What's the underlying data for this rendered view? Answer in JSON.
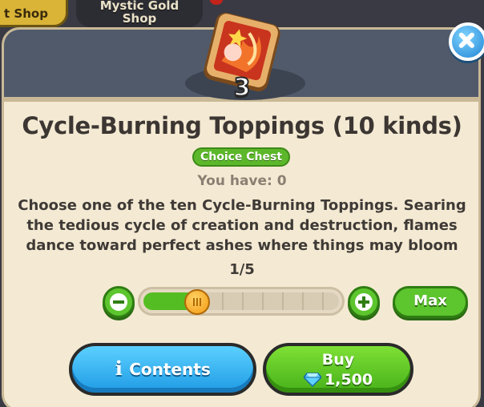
{
  "tabs": {
    "shop": "t Shop",
    "mystic_line1": "Mystic Gold",
    "mystic_line2": "Shop"
  },
  "item": {
    "count": "3",
    "title": "Cycle-Burning Toppings (10 kinds)",
    "badge": "Choice Chest",
    "owned": "You have: 0",
    "description": "Choose one of the ten Cycle-Burning Toppings. Searing the tedious cycle of creation and destruction, flames dance toward perfect ashes where things may bloom evermore."
  },
  "quantity": {
    "counter": "1/5",
    "current": 1,
    "max": 5,
    "max_label": "Max"
  },
  "buttons": {
    "contents_label": "Contents",
    "buy_label": "Buy",
    "price": "1,500",
    "price_icon": "crystal-icon"
  },
  "colors": {
    "accent_green": "#5dc52e",
    "contents_blue": "#1f9be4",
    "badge_green": "#5cb82a"
  }
}
